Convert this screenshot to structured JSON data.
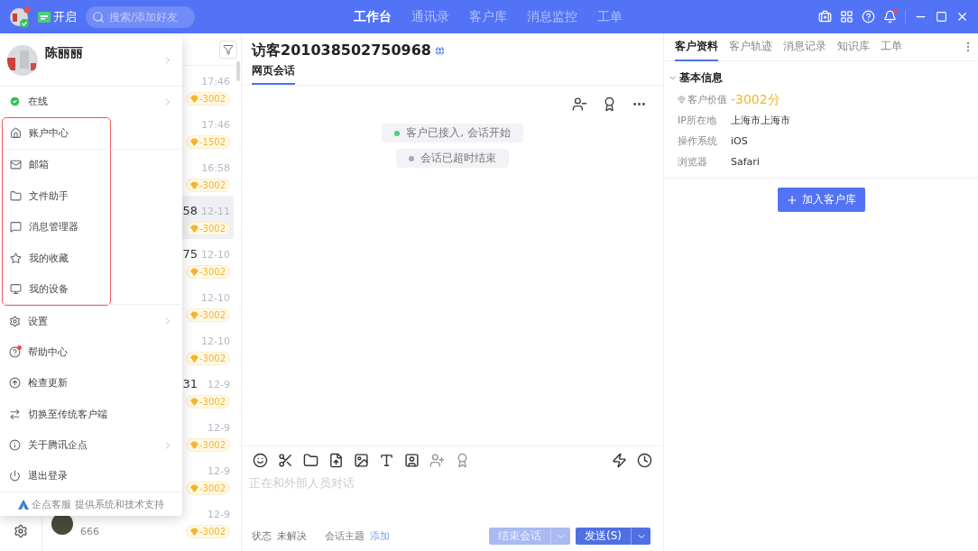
{
  "topbar": {
    "status_label": "开启",
    "search": {
      "placeholder": "搜索/添加好友"
    },
    "nav": [
      {
        "label": "工作台",
        "selected": true
      },
      {
        "label": "通讯录",
        "selected": false
      },
      {
        "label": "客户库",
        "selected": false
      },
      {
        "label": "消息监控",
        "selected": false
      },
      {
        "label": "工单",
        "selected": false
      }
    ]
  },
  "conversations": [
    {
      "time": "17:46",
      "badge": "-3002",
      "selected": false
    },
    {
      "time": "17:46",
      "badge": "-1502",
      "selected": false
    },
    {
      "time": "16:58",
      "badge": "-3002",
      "selected": false
    },
    {
      "name_tail": "58",
      "time": "12-11",
      "badge": "-3002",
      "selected": true
    },
    {
      "name_tail": "75",
      "time": "12-10",
      "badge": "-3002",
      "selected": false
    },
    {
      "time": "12-10",
      "badge": "-3002",
      "selected": false
    },
    {
      "time": "12-10",
      "badge": "-3002",
      "selected": false
    },
    {
      "name_tail": "31",
      "time": "12-9",
      "badge": "-3002",
      "selected": false
    },
    {
      "time": "12-9",
      "badge": "-3002",
      "selected": false
    },
    {
      "time": "12-9",
      "badge": "-3002",
      "selected": false
    },
    {
      "time": "12-9",
      "badge": "-3002",
      "selected": false,
      "preview": "666"
    }
  ],
  "menu": {
    "user": "陈丽丽",
    "status": "在线",
    "items": [
      {
        "label": "账户中心",
        "highlighted": true,
        "submenu": false,
        "dot": false,
        "divider_after": true
      },
      {
        "label": "邮箱",
        "highlighted": true,
        "submenu": false,
        "dot": false,
        "divider_after": false
      },
      {
        "label": "文件助手",
        "highlighted": true,
        "submenu": false,
        "dot": false,
        "divider_after": false
      },
      {
        "label": "消息管理器",
        "highlighted": true,
        "submenu": false,
        "dot": false,
        "divider_after": false
      },
      {
        "label": "我的收藏",
        "highlighted": true,
        "submenu": false,
        "dot": false,
        "divider_after": false
      },
      {
        "label": "我的设备",
        "highlighted": true,
        "submenu": false,
        "dot": false,
        "divider_after": true
      },
      {
        "label": "设置",
        "highlighted": false,
        "submenu": true,
        "dot": false,
        "divider_after": false
      },
      {
        "label": "帮助中心",
        "highlighted": false,
        "submenu": false,
        "dot": true,
        "divider_after": false
      },
      {
        "label": "检查更新",
        "highlighted": false,
        "submenu": false,
        "dot": false,
        "divider_after": false
      },
      {
        "label": "切换至传统客户端",
        "highlighted": false,
        "submenu": false,
        "dot": false,
        "divider_after": false
      },
      {
        "label": "关于腾讯企点",
        "highlighted": false,
        "submenu": true,
        "dot": false,
        "divider_after": false
      },
      {
        "label": "退出登录",
        "highlighted": false,
        "submenu": false,
        "dot": false,
        "divider_after": false
      }
    ],
    "footer": "企点客服 提供系统和技术支持"
  },
  "chat": {
    "title": "访客201038502750968",
    "tabs": [
      {
        "label": "网页会话",
        "selected": true
      }
    ],
    "events": [
      {
        "text": "客户已接入, 会话开始",
        "color": "#4cd07d"
      },
      {
        "text": "会话已超时结束",
        "color": "#a4a9bb"
      }
    ],
    "input": {
      "placeholder": "正在和外部人员对话"
    },
    "status_label": "状态",
    "status_value": "未解决",
    "topic_label": "会话主题",
    "topic_link": "添加",
    "buttons": [
      {
        "label": "结束会话",
        "disabled": true
      },
      {
        "label": "发送(S)",
        "disabled": false
      }
    ]
  },
  "customer": {
    "tabs": [
      {
        "label": "客户资料",
        "selected": true
      },
      {
        "label": "客户轨迹",
        "selected": false
      },
      {
        "label": "消息记录",
        "selected": false
      },
      {
        "label": "知识库",
        "selected": false
      },
      {
        "label": "工单",
        "selected": false
      }
    ],
    "section": {
      "title": "基本信息",
      "expanded": true,
      "fields": [
        {
          "label": "客户价值",
          "value": "-3002分",
          "kind": "score"
        },
        {
          "label": "IP所在地",
          "value": "上海市上海市",
          "kind": "text"
        },
        {
          "label": "操作系统",
          "value": "iOS",
          "kind": "text"
        },
        {
          "label": "浏览器",
          "value": "Safari",
          "kind": "text"
        }
      ]
    },
    "add_button": "加入客户库"
  }
}
